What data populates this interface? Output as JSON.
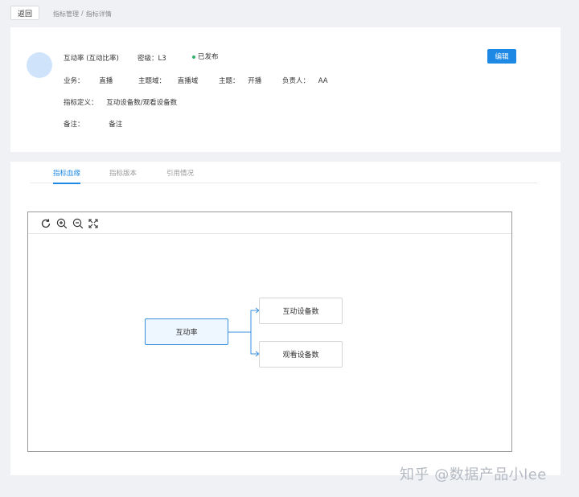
{
  "header": {
    "back_label": "返回",
    "breadcrumb": [
      "指标管理",
      "指标详情"
    ],
    "breadcrumb_sep": "/"
  },
  "info": {
    "title": "互动率 (互动比率)",
    "level_label": "密级：",
    "level_value": "L3",
    "status": "已发布",
    "status_color": "#32b06d",
    "business_label": "业务：",
    "business_value": "直播",
    "domain_label": "主题域：",
    "domain_value": "直播域",
    "topic_label": "主题：",
    "topic_value": "开播",
    "owner_label": "负责人：",
    "owner_value": "AA",
    "definition_label": "指标定义：",
    "definition_value": "互动设备数/观看设备数",
    "remark_label": "备注：",
    "remark_value": "备注",
    "edit_label": "编辑"
  },
  "tabs": [
    {
      "label": "指标血缘",
      "active": true
    },
    {
      "label": "指标版本",
      "active": false
    },
    {
      "label": "引用情况",
      "active": false
    }
  ],
  "toolbar": {
    "icons": [
      "refresh-icon",
      "zoom-in-icon",
      "zoom-out-icon",
      "fullscreen-icon"
    ]
  },
  "lineage": {
    "root": "互动率",
    "children": [
      "互动设备数",
      "观看设备数"
    ],
    "edge_color": "#3a8fdc"
  },
  "watermark": "知乎 @数据产品小lee",
  "colors": {
    "accent": "#1e88e5",
    "background": "#eff1f5",
    "avatar": "#cfe4fb"
  }
}
